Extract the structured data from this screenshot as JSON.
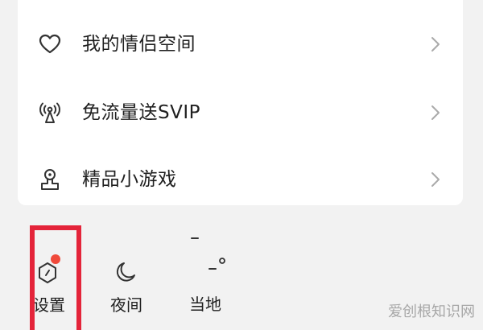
{
  "menu": {
    "items": [
      {
        "label": "我的情侣空间",
        "icon": "heart-icon"
      },
      {
        "label": "免流量送SVIP",
        "icon": "signal-tower-icon"
      },
      {
        "label": "精品小游戏",
        "icon": "game-controller-icon"
      }
    ]
  },
  "bottom_bar": {
    "settings": {
      "label": "设置",
      "icon": "settings-hexagon-icon",
      "badge_color": "#f04a3b"
    },
    "night": {
      "label": "夜间",
      "icon": "moon-icon"
    },
    "local": {
      "label": "当地",
      "icon": "temperature-icon"
    }
  },
  "colors": {
    "highlight": "#e4243a",
    "background": "#f2f2f2",
    "card": "#ffffff"
  },
  "watermark": "爱创根知识网"
}
